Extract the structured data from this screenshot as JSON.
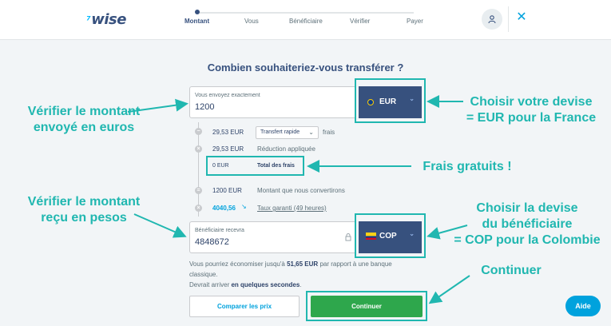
{
  "header": {
    "logo": "wise",
    "steps": [
      "Montant",
      "Vous",
      "Bénéficiaire",
      "Vérifier",
      "Payer"
    ]
  },
  "main": {
    "title": "Combien souhaiteriez-vous transférer ?",
    "send": {
      "label": "Vous envoyez exactement",
      "value": "1200",
      "currency": "EUR"
    },
    "fees": {
      "fee_amount": "29,53 EUR",
      "transfer_type": "Transfert rapide",
      "fee_label": "frais",
      "reduction_amount": "29,53 EUR",
      "reduction_label": "Réduction appliquée",
      "total_amount": "0 EUR",
      "total_label": "Total des frais",
      "convert_amount": "1200 EUR",
      "convert_label": "Montant que nous convertirons",
      "rate": "4040,56",
      "rate_label": "Taux garanti (49 heures)"
    },
    "receive": {
      "label": "Bénéficiaire recevra",
      "value": "4848672",
      "currency": "COP"
    },
    "savings_prefix": "Vous pourriez économiser jusqu'à",
    "savings_amount": "51,65 EUR",
    "savings_suffix": "par rapport à une banque",
    "savings_suffix2": "classique.",
    "arrival_prefix": "Devrait arriver",
    "arrival_value": "en quelques secondes",
    "arrival_suffix": ".",
    "compare_button": "Comparer les prix",
    "continue_button": "Continuer",
    "help_button": "Aide"
  },
  "annotations": {
    "verify_sent_1": "Vérifier le montant",
    "verify_sent_2": "envoyé en euros",
    "choose_currency_1": "Choisir votre devise",
    "choose_currency_2": "= EUR pour la France",
    "free_fees": "Frais gratuits !",
    "verify_received_1": "Vérifier le montant",
    "verify_received_2": "reçu en pesos",
    "choose_recipient_1": "Choisir la devise",
    "choose_recipient_2": "du bénéficiaire",
    "choose_recipient_3": "= COP pour la Colombie",
    "continue": "Continuer"
  },
  "colors": {
    "brand": "#37517e",
    "accent": "#00a2dd",
    "annotation": "#20b7b0",
    "continue": "#2ea74c"
  },
  "icons": [
    "wise-flag-icon",
    "user-icon",
    "close-icon",
    "eur-flag-icon",
    "cop-flag-icon",
    "chevron-down-icon",
    "lock-icon"
  ]
}
